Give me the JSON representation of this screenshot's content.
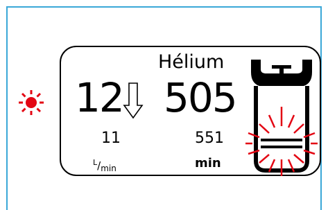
{
  "gas": {
    "name": "Hélium"
  },
  "flow": {
    "current_value": "12",
    "set_value": "11",
    "unit_numerator": "L",
    "unit_separator": "/",
    "unit_denominator": "min",
    "trend_icon": "arrow-down-outline-icon"
  },
  "remaining_time": {
    "current_value": "505",
    "set_value": "551",
    "unit": "min"
  },
  "alarm": {
    "icon": "alarm-light-icon",
    "color": "#e30613"
  },
  "cylinder": {
    "icon": "gas-cylinder-low-level-icon",
    "alert_color": "#e30613"
  },
  "colors": {
    "frame_border": "#3aa7d8",
    "text": "#000000",
    "background": "#ffffff"
  }
}
